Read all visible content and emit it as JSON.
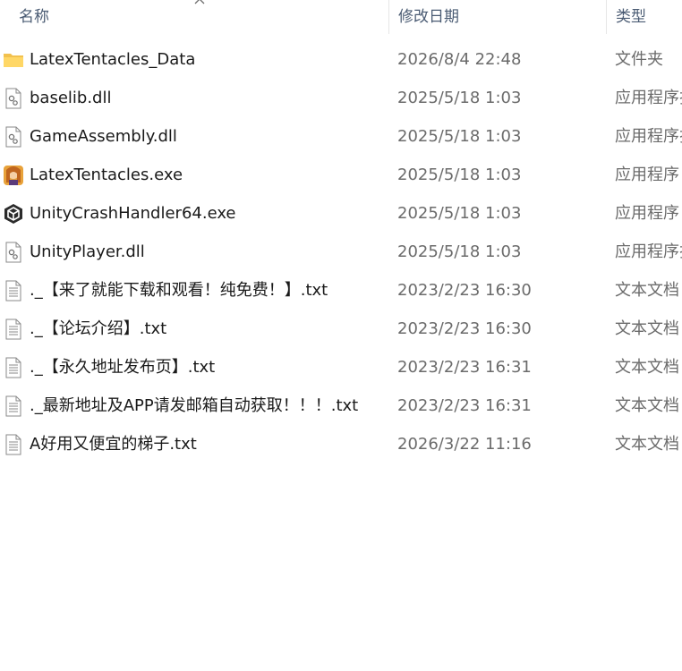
{
  "header": {
    "name_label": "名称",
    "date_label": "修改日期",
    "type_label": "类型",
    "sort_indicator": "chevron-up-icon"
  },
  "files": [
    {
      "name": "LatexTentacles_Data",
      "date": "2026/8/4 22:48",
      "type": "文件夹",
      "icon": "folder-icon"
    },
    {
      "name": "baselib.dll",
      "date": "2025/5/18 1:03",
      "type": "应用程序扩展",
      "icon": "dll-icon"
    },
    {
      "name": "GameAssembly.dll",
      "date": "2025/5/18 1:03",
      "type": "应用程序扩展",
      "icon": "dll-icon"
    },
    {
      "name": "LatexTentacles.exe",
      "date": "2025/5/18 1:03",
      "type": "应用程序",
      "icon": "game-exe-icon"
    },
    {
      "name": "UnityCrashHandler64.exe",
      "date": "2025/5/18 1:03",
      "type": "应用程序",
      "icon": "unity-icon"
    },
    {
      "name": "UnityPlayer.dll",
      "date": "2025/5/18 1:03",
      "type": "应用程序扩展",
      "icon": "dll-icon"
    },
    {
      "name": "._【来了就能下载和观看！纯免费！】.txt",
      "date": "2023/2/23 16:30",
      "type": "文本文档",
      "icon": "text-file-icon"
    },
    {
      "name": "._【论坛介绍】.txt",
      "date": "2023/2/23 16:30",
      "type": "文本文档",
      "icon": "text-file-icon"
    },
    {
      "name": "._【永久地址发布页】.txt",
      "date": "2023/2/23 16:31",
      "type": "文本文档",
      "icon": "text-file-icon"
    },
    {
      "name": "._最新地址及APP请发邮箱自动获取！！！.txt",
      "date": "2023/2/23 16:31",
      "type": "文本文档",
      "icon": "text-file-icon"
    },
    {
      "name": "A好用又便宜的梯子.txt",
      "date": "2026/3/22 11:16",
      "type": "文本文档",
      "icon": "text-file-icon"
    }
  ]
}
